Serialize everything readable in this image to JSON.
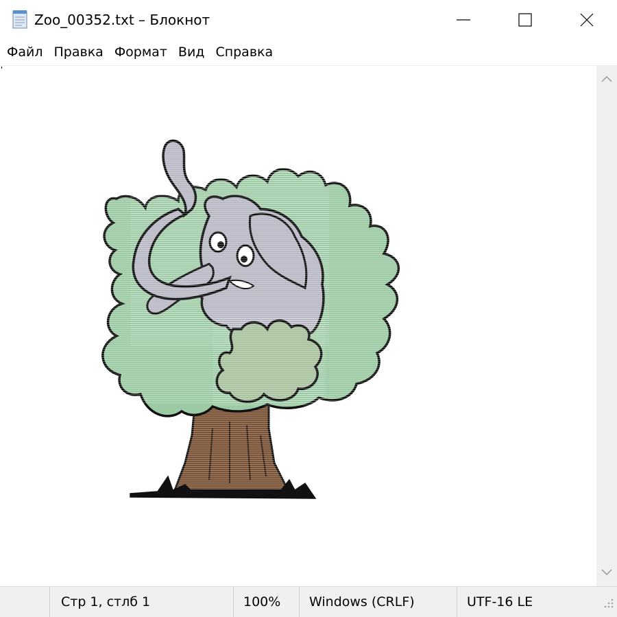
{
  "window": {
    "title": "Zoo_00352.txt – Блокнот",
    "icon": "notepad-icon",
    "controls": {
      "minimize": "minimize-icon",
      "maximize": "maximize-icon",
      "close": "close-icon"
    }
  },
  "menu": {
    "items": [
      {
        "label": "Файл"
      },
      {
        "label": "Правка"
      },
      {
        "label": "Формат"
      },
      {
        "label": "Вид"
      },
      {
        "label": "Справка"
      }
    ]
  },
  "editor": {
    "content": "ascii-art-elephant-in-tree"
  },
  "scrollbar": {
    "up": "chevron-up-icon",
    "down": "chevron-down-icon"
  },
  "status": {
    "position": "Стр 1, стлб 1",
    "zoom": "100%",
    "line_endings": "Windows (CRLF)",
    "encoding": "UTF-16 LE"
  },
  "colors": {
    "foliage": "#9ccaa4",
    "foliage_front": "#a9c3a0",
    "elephant": "#b9b9c6",
    "trunk": "#7a5236",
    "outline": "#111111",
    "chrome": "#f0f0f0"
  }
}
